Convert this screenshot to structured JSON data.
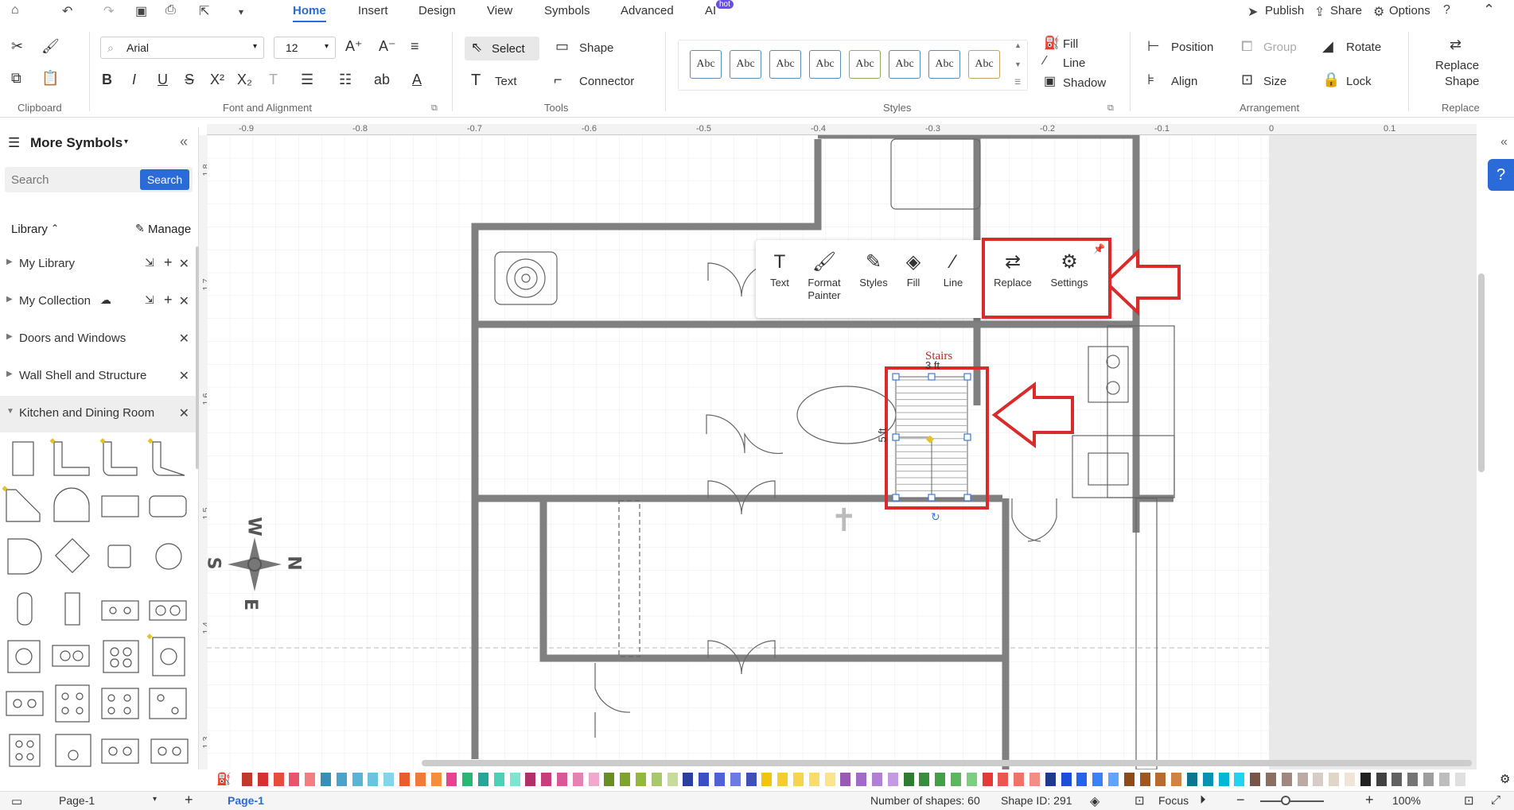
{
  "menu": {
    "tabs": [
      "Home",
      "Insert",
      "Design",
      "View",
      "Symbols",
      "Advanced",
      "AI"
    ],
    "ai_badge": "hot",
    "publish": "Publish",
    "share": "Share",
    "options": "Options"
  },
  "ribbon": {
    "clipboard_label": "Clipboard",
    "font": {
      "family": "Arial",
      "size": "12",
      "group_label": "Font and Alignment"
    },
    "tools": {
      "select": "Select",
      "shape": "Shape",
      "text": "Text",
      "connector": "Connector",
      "group_label": "Tools"
    },
    "styles": {
      "items": [
        "Abc",
        "Abc",
        "Abc",
        "Abc",
        "Abc",
        "Abc",
        "Abc",
        "Abc"
      ],
      "colors": [
        "#5b8db8",
        "#5b8db8",
        "#5b8db8",
        "#5b8db8",
        "#8dac5e",
        "#5b8db8",
        "#5b8db8",
        "#c4a55e"
      ],
      "fill": "Fill",
      "line": "Line",
      "shadow": "Shadow",
      "group_label": "Styles"
    },
    "arrangement": {
      "position": "Position",
      "group": "Group",
      "rotate": "Rotate",
      "align": "Align",
      "size": "Size",
      "lock": "Lock",
      "group_label": "Arrangement"
    },
    "replace": {
      "label1": "Replace",
      "label2": "Shape",
      "group_label": "Replace"
    }
  },
  "sidebar": {
    "title": "More Symbols",
    "search_placeholder": "Search",
    "search_button": "Search",
    "library_label": "Library",
    "manage": "Manage",
    "items": [
      {
        "label": "My Library"
      },
      {
        "label": "My Collection"
      },
      {
        "label": "Doors and Windows"
      },
      {
        "label": "Wall Shell and Structure"
      },
      {
        "label": "Kitchen and Dining Room"
      }
    ]
  },
  "ruler": {
    "top": [
      "-0.9",
      "-0.8",
      "-0.7",
      "-0.6",
      "-0.5",
      "-0.4",
      "-0.3",
      "-0.2",
      "-0.1",
      "0",
      "0.1"
    ],
    "left": [
      "1.8",
      "1.7",
      "1.6",
      "1.5",
      "1.4",
      "1.3"
    ]
  },
  "floatbar": {
    "items": [
      "Text",
      "Format Painter",
      "Styles",
      "Fill",
      "Line",
      "Replace",
      "Settings"
    ]
  },
  "canvas": {
    "stairs_label": "Stairs",
    "dim_top": "3 ft",
    "dim_side": "5 ft",
    "compass": {
      "n": "N",
      "s": "S",
      "e": "E",
      "w": "W"
    }
  },
  "status": {
    "page_selector": "Page-1",
    "page_tab": "Page-1",
    "shapes": "Number of shapes: 60",
    "shape_id": "Shape ID: 291",
    "focus": "Focus",
    "zoom": "100%"
  },
  "palette": [
    "#c0392b",
    "#d63031",
    "#e74c3c",
    "#e8566c",
    "#f08080",
    "#3a8fb7",
    "#4aa3c9",
    "#5ab4d6",
    "#6cc3e0",
    "#87d3ea",
    "#e85d2b",
    "#f07a3a",
    "#f3903f",
    "#e84393",
    "#2bb673",
    "#26a69a",
    "#4dd0b5",
    "#80e5d0",
    "#b0306a",
    "#c73e7f",
    "#d65a95",
    "#e383b3",
    "#f0a8cc",
    "#6b8e23",
    "#7fa32f",
    "#93b83f",
    "#a8c96a",
    "#c8dc9a",
    "#2c3e9e",
    "#3a4fc2",
    "#4f63d6",
    "#6b7be3",
    "#3f51b5",
    "#f1c40f",
    "#f5cd2e",
    "#f7d44d",
    "#f9dc6a",
    "#fbe58a",
    "#9b59b6",
    "#a06bc9",
    "#b07fd6",
    "#c49ae3",
    "#2e7d32",
    "#388e3c",
    "#43a047",
    "#5cb860",
    "#7ccf80",
    "#e53935",
    "#e9574f",
    "#ee7368",
    "#f28f85",
    "#1e3a8a",
    "#1d4ed8",
    "#2563eb",
    "#3b82f6",
    "#60a5fa",
    "#8d4b1a",
    "#a0571f",
    "#b86b2e",
    "#cf8447",
    "#0e7490",
    "#0891b2",
    "#06b6d4",
    "#22d3ee",
    "#795548",
    "#8d6e63",
    "#a1887f",
    "#bcaaa4",
    "#d7ccc8",
    "#e0d6c8",
    "#eee5d8",
    "#212121",
    "#424242",
    "#616161",
    "#757575",
    "#9e9e9e",
    "#bdbdbd",
    "#e0e0e0"
  ]
}
